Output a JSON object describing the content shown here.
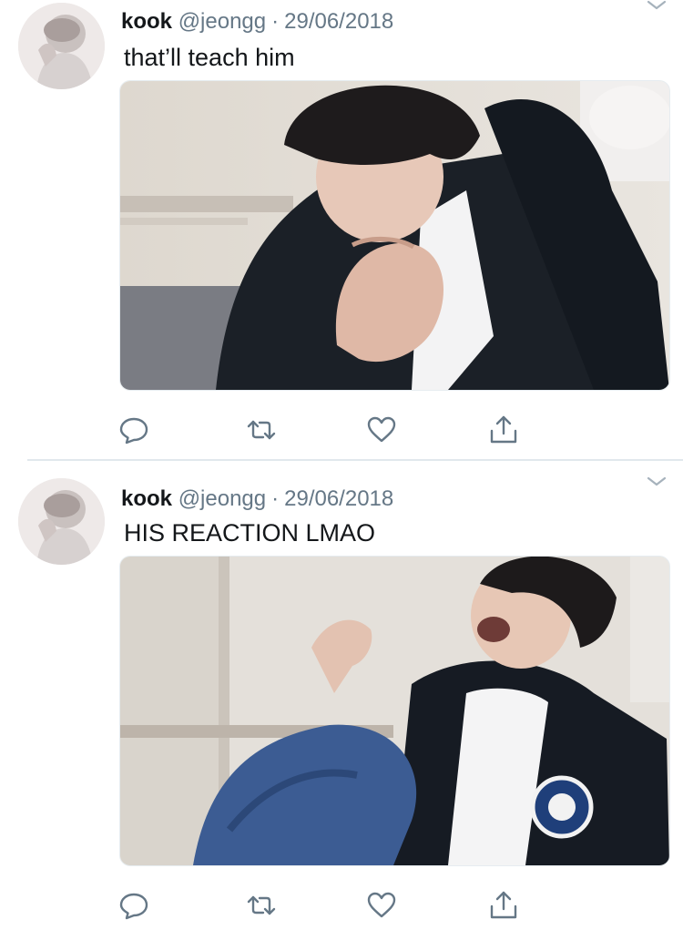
{
  "tweets": [
    {
      "author_name": "kook",
      "handle": "@jeongg",
      "separator": "·",
      "date": "29/06/2018",
      "text": "that’ll teach him"
    },
    {
      "author_name": "kook",
      "handle": "@jeongg",
      "separator": "·",
      "date": "29/06/2018",
      "text": "HIS REACTION LMAO"
    }
  ],
  "icons": {
    "reply": "reply-icon",
    "retweet": "retweet-icon",
    "like": "heart-icon",
    "share": "share-icon",
    "more": "chevron-down-icon"
  },
  "colors": {
    "text": "#14171a",
    "muted": "#657786",
    "divider": "#e1e8ed"
  }
}
